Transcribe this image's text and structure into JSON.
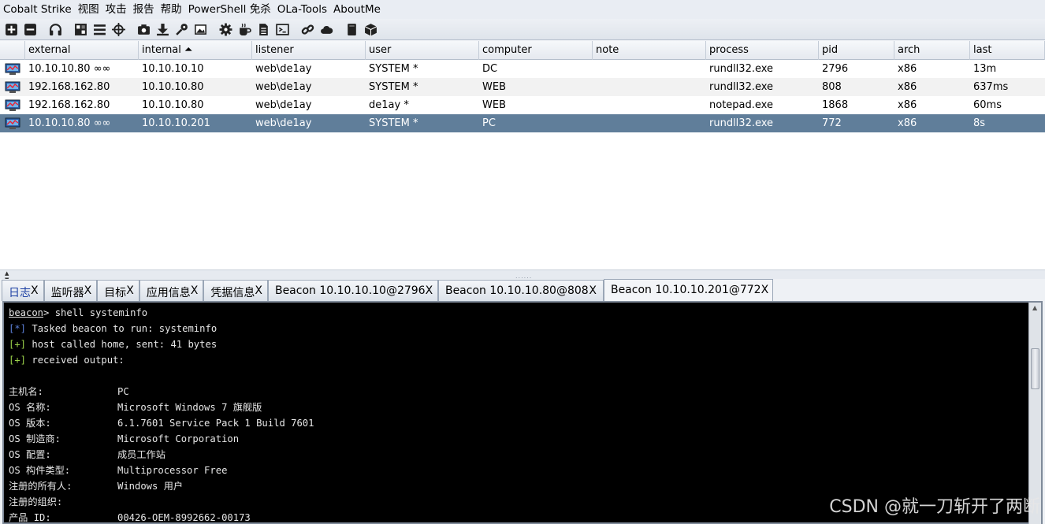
{
  "menu": [
    "Cobalt Strike",
    "视图",
    "攻击",
    "报告",
    "帮助",
    "PowerShell 免杀",
    "OLa-Tools",
    "AboutMe"
  ],
  "toolbar": [
    "plus-icon",
    "minus-icon",
    "headphones-icon",
    "network-graph-icon",
    "list-icon",
    "crosshair-icon",
    "camera-icon",
    "download-icon",
    "key-icon",
    "image-icon",
    "gear-icon",
    "coffee-icon",
    "document-icon",
    "terminal-icon",
    "link-icon",
    "cloud-icon",
    "book-icon",
    "package-icon"
  ],
  "table": {
    "columns": [
      "external",
      "internal ⏶",
      "listener",
      "user",
      "computer",
      "note",
      "process",
      "pid",
      "arch",
      "last"
    ],
    "rows": [
      {
        "external": "10.10.10.80 ∞∞",
        "internal": "10.10.10.10",
        "listener": "web\\de1ay",
        "user": "SYSTEM *",
        "computer": "DC",
        "note": "",
        "process": "rundll32.exe",
        "pid": "2796",
        "arch": "x86",
        "last": "13m"
      },
      {
        "external": "192.168.162.80",
        "internal": "10.10.10.80",
        "listener": "web\\de1ay",
        "user": "SYSTEM *",
        "computer": "WEB",
        "note": "",
        "process": "rundll32.exe",
        "pid": "808",
        "arch": "x86",
        "last": "637ms"
      },
      {
        "external": "192.168.162.80",
        "internal": "10.10.10.80",
        "listener": "web\\de1ay",
        "user": "de1ay *",
        "computer": "WEB",
        "note": "",
        "process": "notepad.exe",
        "pid": "1868",
        "arch": "x86",
        "last": "60ms"
      },
      {
        "external": "10.10.10.80 ∞∞",
        "internal": "10.10.10.201",
        "listener": "web\\de1ay",
        "user": "SYSTEM *",
        "computer": "PC",
        "note": "",
        "process": "rundll32.exe",
        "pid": "772",
        "arch": "x86",
        "last": "8s"
      }
    ]
  },
  "tabs": [
    {
      "label": "日志",
      "close": "X"
    },
    {
      "label": "监听器",
      "close": "X"
    },
    {
      "label": "目标",
      "close": "X"
    },
    {
      "label": "应用信息",
      "close": "X"
    },
    {
      "label": "凭据信息",
      "close": "X"
    },
    {
      "label": "Beacon 10.10.10.10@2796",
      "close": "X"
    },
    {
      "label": "Beacon 10.10.10.80@808",
      "close": "X"
    },
    {
      "label": "Beacon 10.10.10.201@772",
      "close": "X"
    }
  ],
  "console": {
    "prompt": "beacon",
    "command": "> shell systeminfo",
    "lines": [
      {
        "tag": "[*]",
        "text": " Tasked beacon to run: systeminfo"
      },
      {
        "tag": "[+]",
        "text": " host called home, sent: 41 bytes"
      },
      {
        "tag": "[+]",
        "text": " received output:"
      }
    ],
    "fields": [
      {
        "key": "主机名:",
        "value": "PC"
      },
      {
        "key": "OS 名称:",
        "value": "Microsoft Windows 7 旗舰版"
      },
      {
        "key": "OS 版本:",
        "value": "6.1.7601 Service Pack 1 Build 7601"
      },
      {
        "key": "OS 制造商:",
        "value": "Microsoft Corporation"
      },
      {
        "key": "OS 配置:",
        "value": "成员工作站"
      },
      {
        "key": "OS 构件类型:",
        "value": "Multiprocessor Free"
      },
      {
        "key": "注册的所有人:",
        "value": "Windows 用户"
      },
      {
        "key": "注册的组织:",
        "value": ""
      },
      {
        "key": "产品 ID:",
        "value": "00426-OEM-8992662-00173"
      }
    ]
  },
  "watermark": "CSDN @就一刀斩开了两断",
  "colors": {
    "selected_row": "#607e9a",
    "console_bg": "#000000",
    "tag_blue": "#5b7fd6",
    "tag_green": "#9ad14a"
  }
}
